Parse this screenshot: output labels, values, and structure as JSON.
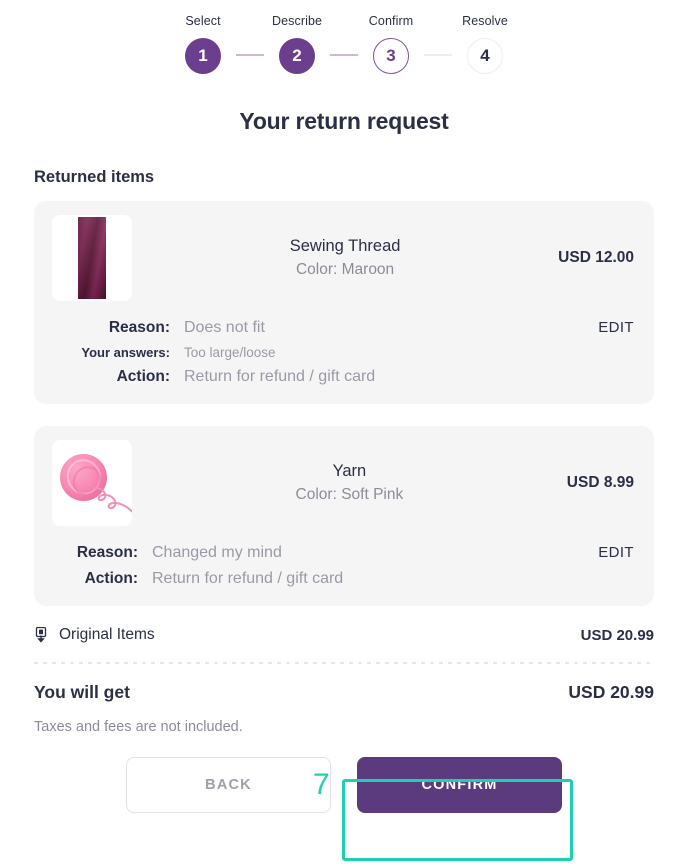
{
  "stepper": {
    "steps": [
      {
        "label": "Select",
        "number": "1",
        "state": "done"
      },
      {
        "label": "Describe",
        "number": "2",
        "state": "done"
      },
      {
        "label": "Confirm",
        "number": "3",
        "state": "current"
      },
      {
        "label": "Resolve",
        "number": "4",
        "state": "todo"
      }
    ]
  },
  "header": {
    "title": "Your return request"
  },
  "sections": {
    "returned_items_title": "Returned items"
  },
  "items": [
    {
      "name": "Sewing Thread",
      "variant": "Color: Maroon",
      "price": "USD 12.00",
      "image": "sewing-thread-spool",
      "edit_label": "EDIT",
      "details": [
        {
          "label": "Reason:",
          "value": "Does not fit"
        },
        {
          "label": "Your answers:",
          "value": "Too large/loose"
        },
        {
          "label": "Action:",
          "value": "Return for refund / gift card"
        }
      ]
    },
    {
      "name": "Yarn",
      "variant": "Color: Soft Pink",
      "price": "USD 8.99",
      "image": "pink-yarn-ball",
      "edit_label": "EDIT",
      "details": [
        {
          "label": "Reason:",
          "value": "Changed my mind"
        },
        {
          "label": "Action:",
          "value": "Return for refund / gift card"
        }
      ]
    }
  ],
  "totals": {
    "original_items_label": "Original Items",
    "original_items_amount": "USD 20.99",
    "grand_label": "You will get",
    "grand_amount": "USD 20.99",
    "note": "Taxes and fees are not included."
  },
  "footer": {
    "back_label": "BACK",
    "confirm_label": "CONFIRM"
  },
  "annotation": {
    "number": "7",
    "color": "#1ecfb0",
    "target": "confirm-button"
  },
  "colors": {
    "purple": "#5b3a7e",
    "step_purple": "#6c3f8e",
    "text_dark": "#2b2f45",
    "text_muted": "#9a9aa6",
    "card_bg": "#f5f5f6",
    "teal": "#1ecfb0"
  }
}
